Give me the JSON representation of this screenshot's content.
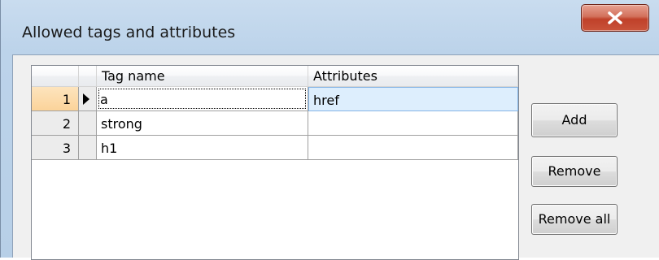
{
  "window": {
    "title": "Allowed tags and attributes",
    "close_icon": "close-icon"
  },
  "grid": {
    "columns": [
      "Tag name",
      "Attributes"
    ],
    "rows": [
      {
        "num": "1",
        "tag": "a",
        "attributes": "href",
        "current": true
      },
      {
        "num": "2",
        "tag": "strong",
        "attributes": ""
      },
      {
        "num": "3",
        "tag": "h1",
        "attributes": ""
      }
    ],
    "row_indicator_icon": "current-row-arrow-icon"
  },
  "buttons": {
    "add": "Add",
    "remove": "Remove",
    "remove_all": "Remove all"
  },
  "colors": {
    "title_bar": "#bcd3ea",
    "close_button": "#c9533a",
    "current_row_header": "#fbd39a",
    "selected_cell": "#ddeefd"
  }
}
